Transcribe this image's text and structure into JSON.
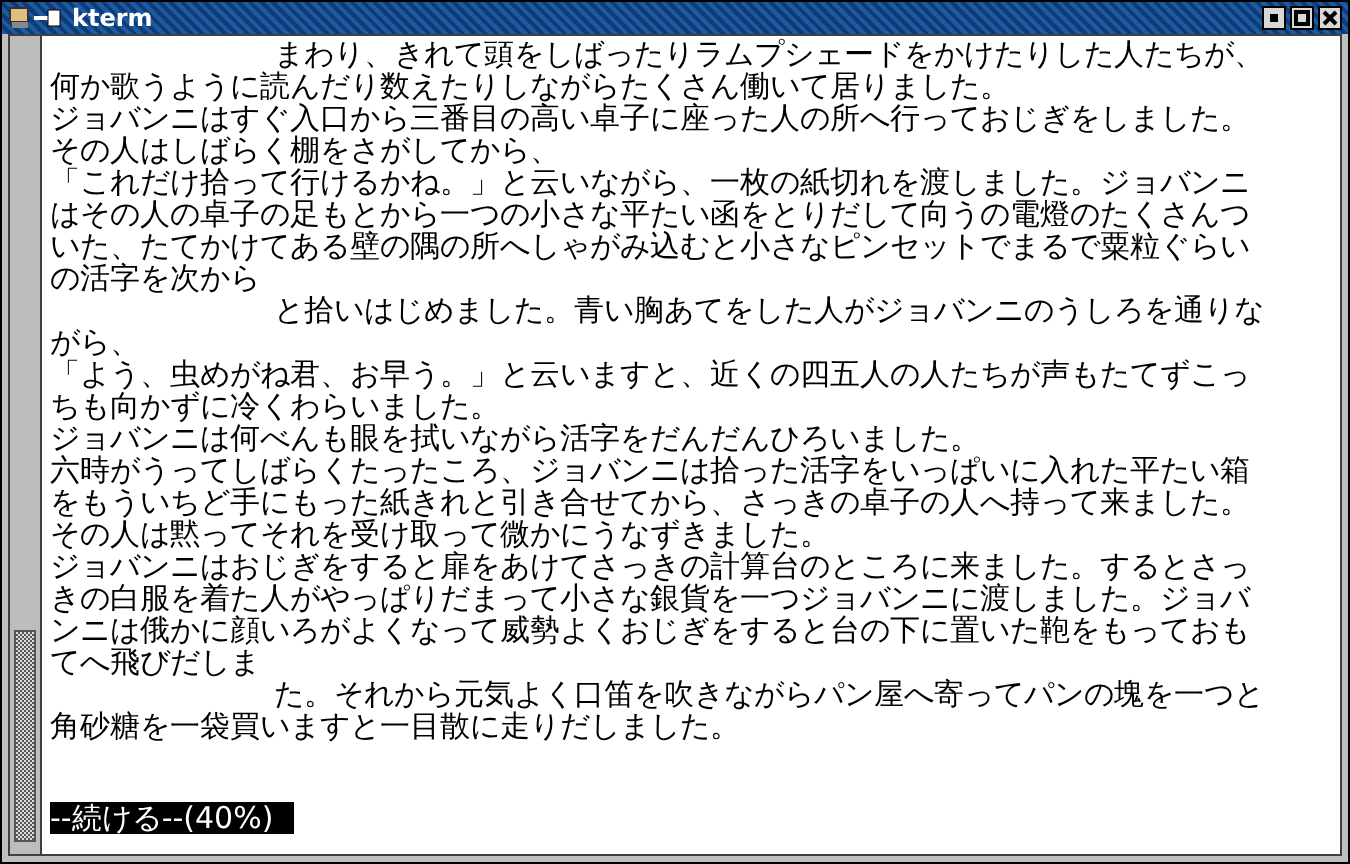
{
  "window": {
    "title": "kterm"
  },
  "lines": [
    {
      "kind": "indented",
      "text": "まわり、きれて頭をしばったりラムプシェードをかけたりした人たちが、"
    },
    {
      "kind": "plain",
      "text": "何か歌うように読んだり数えたりしながらたくさん働いて居りました。"
    },
    {
      "kind": "plain",
      "text": "ジョバンニはすぐ入口から三番目の高い卓子に座った人の所へ行っておじぎをしました。"
    },
    {
      "kind": "plain",
      "text": "その人はしばらく棚をさがしてから、"
    },
    {
      "kind": "plain",
      "text": "「これだけ拾って行けるかね。」と云いながら、一枚の紙切れを渡しました。ジョバンニ"
    },
    {
      "kind": "plain",
      "text": "はその人の卓子の足もとから一つの小さな平たい函をとりだして向うの電燈のたくさんつ"
    },
    {
      "kind": "plain",
      "text": "いた、たてかけてある壁の隅の所へしゃがみ込むと小さなピンセットでまるで粟粒ぐらい"
    },
    {
      "kind": "plain",
      "text": "の活字を次から"
    },
    {
      "kind": "indented",
      "text": "と拾いはじめました。青い胸あてをした人がジョバンニのうしろを通りな"
    },
    {
      "kind": "plain",
      "text": "がら、"
    },
    {
      "kind": "plain",
      "text": "「よう、虫めがね君、お早う。」と云いますと、近くの四五人の人たちが声もたてずこっ"
    },
    {
      "kind": "plain",
      "text": "ちも向かずに冷くわらいました。"
    },
    {
      "kind": "plain",
      "text": "ジョバンニは何べんも眼を拭いながら活字をだんだんひろいました。"
    },
    {
      "kind": "plain",
      "text": "六時がうってしばらくたったころ、ジョバンニは拾った活字をいっぱいに入れた平たい箱"
    },
    {
      "kind": "plain",
      "text": "をもういちど手にもった紙きれと引き合せてから、さっきの卓子の人へ持って来ました。"
    },
    {
      "kind": "plain",
      "text": "その人は黙ってそれを受け取って微かにうなずきました。"
    },
    {
      "kind": "plain",
      "text": "ジョバンニはおじぎをすると扉をあけてさっきの計算台のところに来ました。するとさっ"
    },
    {
      "kind": "plain",
      "text": "きの白服を着た人がやっぱりだまって小さな銀貨を一つジョバンニに渡しました。ジョバ"
    },
    {
      "kind": "plain",
      "text": "ンニは俄かに顔いろがよくなって威勢よくおじぎをすると台の下に置いた鞄をもっておも"
    },
    {
      "kind": "plain",
      "text": "てへ飛びだしま"
    },
    {
      "kind": "indented",
      "text": "た。それから元気よく口笛を吹きながらパン屋へ寄ってパンの塊を一つと"
    },
    {
      "kind": "plain",
      "text": "角砂糖を一袋買いますと一目散に走りだしました。"
    }
  ],
  "prompt": "--続ける--(40%)"
}
